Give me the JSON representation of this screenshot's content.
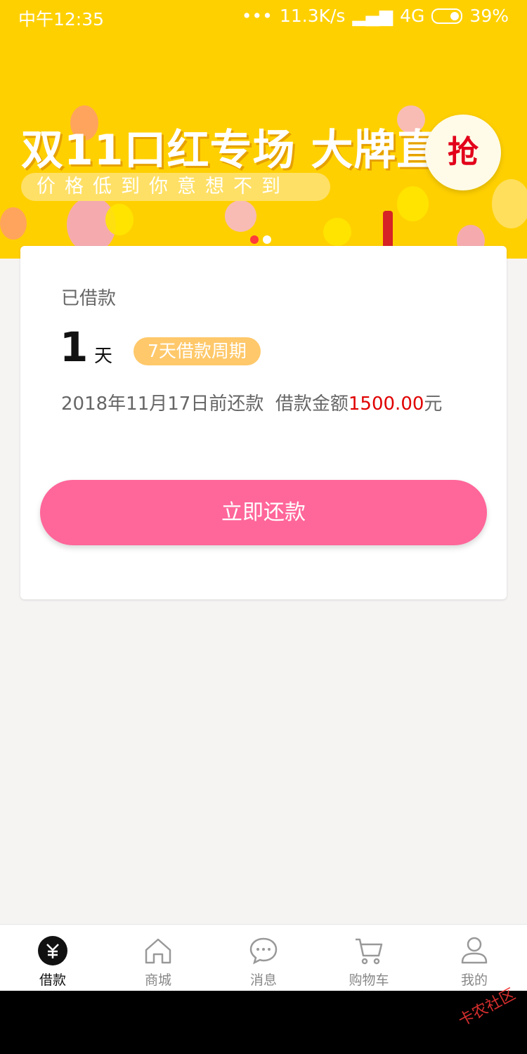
{
  "status_bar": {
    "time": "中午12:35",
    "network_speed": "11.3K/s",
    "network_type": "4G",
    "battery": "39%"
  },
  "banner": {
    "title": "双11口红专场 大牌直降",
    "subtitle": "价格低到你意想不到",
    "button": "抢"
  },
  "loan_card": {
    "label": "已借款",
    "days": "1",
    "days_unit": "天",
    "cycle_badge": "7天借款周期",
    "due_text": "2018年11月17日前还款",
    "amount_label": "借款金额",
    "amount_value": "1500.00",
    "amount_unit": "元",
    "repay_button": "立即还款"
  },
  "tabs": [
    {
      "label": "借款",
      "icon": "yuan-icon",
      "active": true
    },
    {
      "label": "商城",
      "icon": "home-icon"
    },
    {
      "label": "消息",
      "icon": "chat-icon"
    },
    {
      "label": "购物车",
      "icon": "cart-icon"
    },
    {
      "label": "我的",
      "icon": "user-icon"
    }
  ],
  "watermark": "卡农社区",
  "colors": {
    "banner": "#ffd000",
    "accent": "#ff6699",
    "amount": "#e00000",
    "badge": "#ffc86a"
  }
}
